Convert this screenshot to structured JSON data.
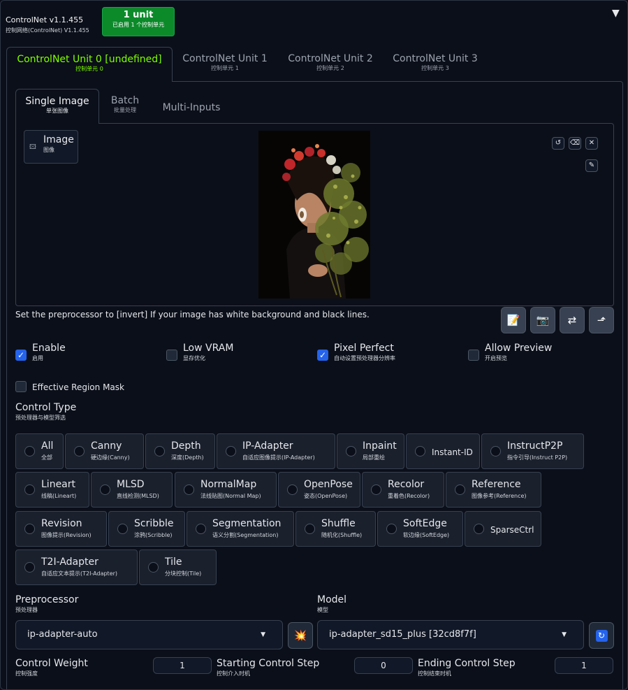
{
  "header": {
    "title": "ControlNet v1.1.455",
    "subtitle": "控制网络(ControlNet) V1.1.455",
    "badge_main": "1 unit",
    "badge_sub": "已启用 1 个控制单元",
    "collapse_icon": "▼"
  },
  "unit_tabs": [
    {
      "label": "ControlNet Unit 0 [undefined]",
      "sub": "控制单元 0"
    },
    {
      "label": "ControlNet Unit 1",
      "sub": "控制单元 1"
    },
    {
      "label": "ControlNet Unit 2",
      "sub": "控制单元 2"
    },
    {
      "label": "ControlNet Unit 3",
      "sub": "控制单元 3"
    }
  ],
  "input_tabs": [
    {
      "label": "Single Image",
      "sub": "单张图像"
    },
    {
      "label": "Batch",
      "sub": "批量处理"
    },
    {
      "label": "Multi-Inputs",
      "sub": ""
    }
  ],
  "image": {
    "label": "Image",
    "sub": "图像",
    "icon": "image-icon"
  },
  "image_buttons": [
    "undo-icon",
    "eraser-icon",
    "close-icon",
    "brush-icon"
  ],
  "hint": "Set the preprocessor to [invert] If your image has white background and black lines.",
  "tool_buttons": [
    "edit-icon",
    "camera-icon",
    "swap-icon",
    "send-dimensions-icon"
  ],
  "checks": [
    {
      "label": "Enable",
      "sub": "启用",
      "checked": true
    },
    {
      "label": "Low VRAM",
      "sub": "显存优化",
      "checked": false
    },
    {
      "label": "Pixel Perfect",
      "sub": "自动设置预处理器分辨率",
      "checked": true
    },
    {
      "label": "Allow Preview",
      "sub": "开启预览",
      "checked": false
    }
  ],
  "region_mask": {
    "label": "Effective Region Mask",
    "checked": false
  },
  "control_type": {
    "title": "Control Type",
    "sub": "预处理器与模型筛选",
    "options": [
      {
        "label": "All",
        "sub": "全部"
      },
      {
        "label": "Canny",
        "sub": "硬边缘(Canny)"
      },
      {
        "label": "Depth",
        "sub": "深度(Depth)"
      },
      {
        "label": "IP-Adapter",
        "sub": "自适应图像提示(IP-Adapter)"
      },
      {
        "label": "Inpaint",
        "sub": "局部重绘"
      },
      {
        "label": "Instant-ID",
        "sub": ""
      },
      {
        "label": "InstructP2P",
        "sub": "指令引导(Instruct P2P)"
      },
      {
        "label": "Lineart",
        "sub": "线稿(Lineart)"
      },
      {
        "label": "MLSD",
        "sub": "直线检测(MLSD)"
      },
      {
        "label": "NormalMap",
        "sub": "法线贴图(Normal Map)"
      },
      {
        "label": "OpenPose",
        "sub": "姿态(OpenPose)"
      },
      {
        "label": "Recolor",
        "sub": "重着色(Recolor)"
      },
      {
        "label": "Reference",
        "sub": "图像参考(Reference)"
      },
      {
        "label": "Revision",
        "sub": "图像提示(Revision)"
      },
      {
        "label": "Scribble",
        "sub": "涂鸦(Scribble)"
      },
      {
        "label": "Segmentation",
        "sub": "语义分割(Segmentation)"
      },
      {
        "label": "Shuffle",
        "sub": "随机化(Shuffle)"
      },
      {
        "label": "SoftEdge",
        "sub": "软边缘(SoftEdge)"
      },
      {
        "label": "SparseCtrl",
        "sub": ""
      },
      {
        "label": "T2I-Adapter",
        "sub": "自适应文本提示(T2I-Adapter)"
      },
      {
        "label": "Tile",
        "sub": "分块控制(Tile)"
      }
    ]
  },
  "preprocessor": {
    "label": "Preprocessor",
    "sub": "预处理器",
    "value": "ip-adapter-auto",
    "run_icon": "explosion-icon"
  },
  "model": {
    "label": "Model",
    "sub": "模型",
    "value": "ip-adapter_sd15_plus [32cd8f7f]",
    "refresh_icon": "refresh-icon"
  },
  "sliders": [
    {
      "label": "Control Weight",
      "sub": "控制强度",
      "value": "1"
    },
    {
      "label": "Starting Control Step",
      "sub": "控制介入时机",
      "value": "0"
    },
    {
      "label": "Ending Control Step",
      "sub": "控制结束时机",
      "value": "1"
    }
  ],
  "colors": {
    "accent": "#7fff00",
    "badge": "#0c8a2a",
    "checkbox": "#2563eb",
    "bg": "#0b0f19"
  }
}
